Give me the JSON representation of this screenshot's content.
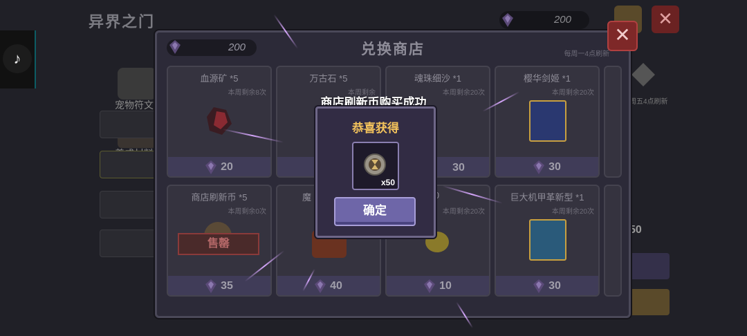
{
  "background": {
    "title": "异界之门",
    "currency_amount": "200",
    "side_tabs": [
      {
        "label": "宠物符文"
      },
      {
        "label": "养成材料"
      }
    ],
    "right_note": "每周五4点刷新",
    "right_value": "50"
  },
  "shop": {
    "title": "兑换商店",
    "currency_amount": "200",
    "refresh_note": "每周一4点刷新",
    "items": [
      {
        "name": "血源矿 *5",
        "remain": "本周剩余8次",
        "price": "20",
        "sold_out": false
      },
      {
        "name": "万古石 *5",
        "remain": "本周剩余",
        "price": "",
        "sold_out": false
      },
      {
        "name": "魂珠细沙 *1",
        "remain": "本周剩余20次",
        "price": "30",
        "sold_out": false
      },
      {
        "name": "樱华剑姬 *1",
        "remain": "本周剩余20次",
        "price": "30",
        "sold_out": false
      },
      {
        "name": "商店刷新币 *5",
        "remain": "本周剩余0次",
        "price": "35",
        "sold_out": true,
        "sold_out_label": "售罄"
      },
      {
        "name": "魔",
        "remain": "",
        "price": "40",
        "sold_out": false
      },
      {
        "name": "10000",
        "remain": "本周剩余20次",
        "price": "10",
        "sold_out": false
      },
      {
        "name": "巨大机甲革新型 *1",
        "remain": "本周剩余20次",
        "price": "30",
        "sold_out": false
      }
    ]
  },
  "popup": {
    "toast": "商店刷新币购买成功",
    "title": "恭喜获得",
    "reward_qty": "x50",
    "confirm_label": "确定"
  },
  "colors": {
    "accent_gold": "#f3c35c",
    "button_purple": "#6e66a8",
    "close_red": "#7e2828"
  }
}
